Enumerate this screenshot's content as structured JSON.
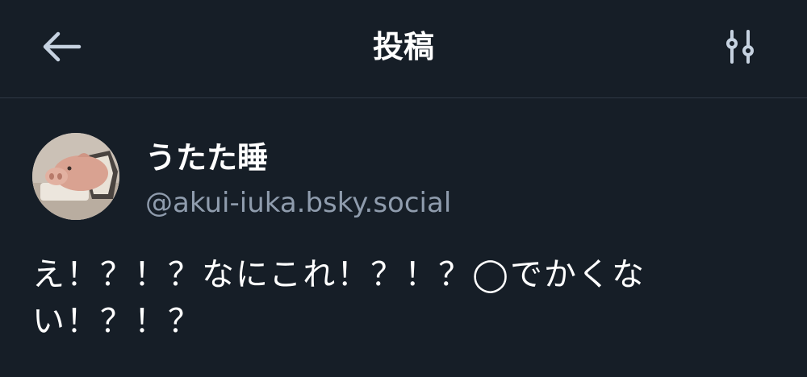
{
  "header": {
    "title": "投稿",
    "back_icon": "arrow-left-icon",
    "filter_icon": "sliders-icon"
  },
  "post": {
    "author": {
      "display_name": "うたた睡",
      "handle": "@akui-iuka.bsky.social",
      "avatar": "plush-pig-avatar"
    },
    "text": "え！？！？なにこれ！？！？◯でかくない！？！？"
  },
  "colors": {
    "background": "#161e27",
    "divider": "#2e3845",
    "text_primary": "#ffffff",
    "text_secondary": "#8f9cad",
    "icon": "#c6d2e0"
  }
}
